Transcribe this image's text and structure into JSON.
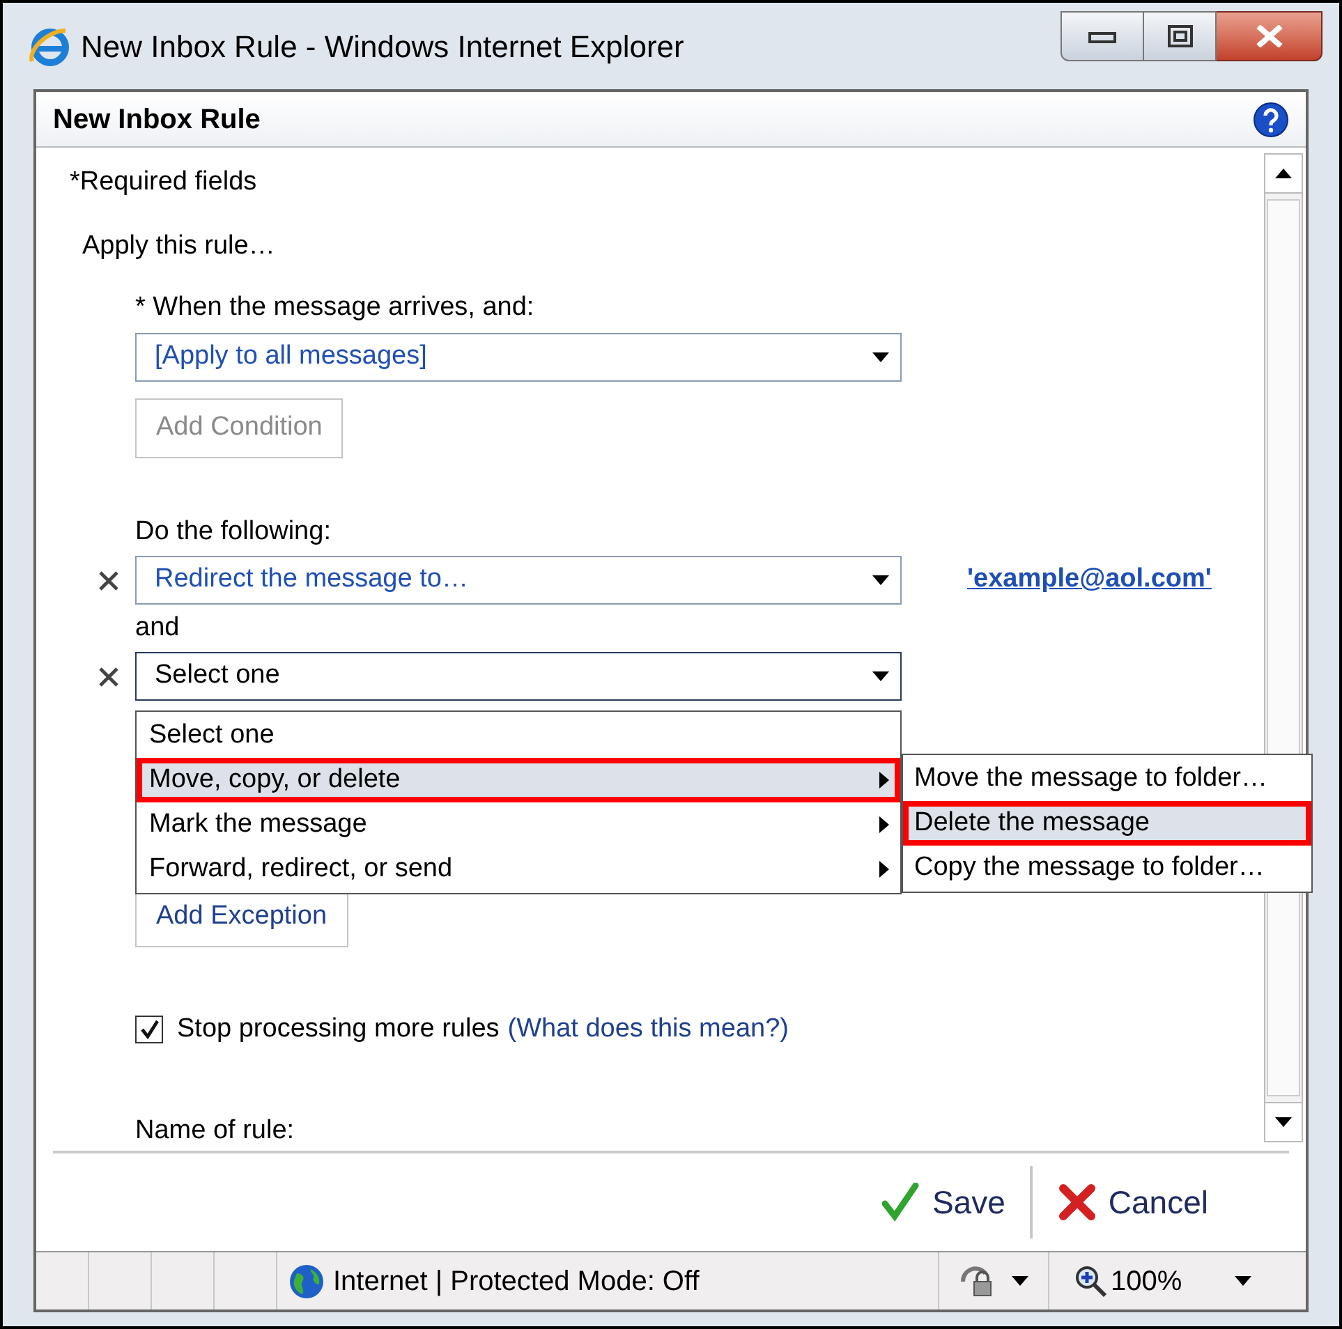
{
  "window": {
    "title": "New Inbox Rule - Windows Internet Explorer"
  },
  "dialog": {
    "title": "New Inbox Rule"
  },
  "required_note": "*Required fields",
  "apply_label": "Apply this rule…",
  "conditions": {
    "label": "* When the message arrives, and:",
    "select": {
      "value": "[Apply to all messages]",
      "kind": "link"
    },
    "add_button": {
      "label": "Add Condition",
      "disabled": true
    }
  },
  "actions": {
    "label": "Do the following:",
    "joiner": "and",
    "rows": [
      {
        "value": "Redirect the message to…",
        "kind": "link",
        "argument": "'example@aol.com'",
        "open": false
      },
      {
        "value": "Select one",
        "kind": "plain",
        "open": true
      }
    ]
  },
  "menu": {
    "items": [
      {
        "label": "Select one",
        "has_submenu": false,
        "selected": false,
        "outlined": false
      },
      {
        "label": "Move, copy, or delete",
        "has_submenu": true,
        "selected": true,
        "outlined": true
      },
      {
        "label": "Mark the message",
        "has_submenu": true,
        "selected": false,
        "outlined": false
      },
      {
        "label": "Forward, redirect, or send",
        "has_submenu": true,
        "selected": false,
        "outlined": false
      }
    ]
  },
  "submenu": {
    "items": [
      {
        "label": "Move the message to folder…",
        "selected": false,
        "outlined": false
      },
      {
        "label": "Delete the message",
        "selected": true,
        "outlined": true
      },
      {
        "label": "Copy the message to folder…",
        "selected": false,
        "outlined": false
      }
    ]
  },
  "exceptions": {
    "add_button": {
      "label": "Add Exception",
      "disabled": false
    }
  },
  "stop_processing": {
    "checked": true,
    "label": "Stop processing more rules",
    "link": "(What does this mean?)"
  },
  "name_label": "Name of rule:",
  "footer": {
    "buttons": [
      {
        "kind": "save",
        "label": "Save"
      },
      {
        "kind": "cancel",
        "label": "Cancel"
      }
    ]
  },
  "status_bar": {
    "zone": "Internet | Protected Mode: Off",
    "zoom": "100%"
  }
}
